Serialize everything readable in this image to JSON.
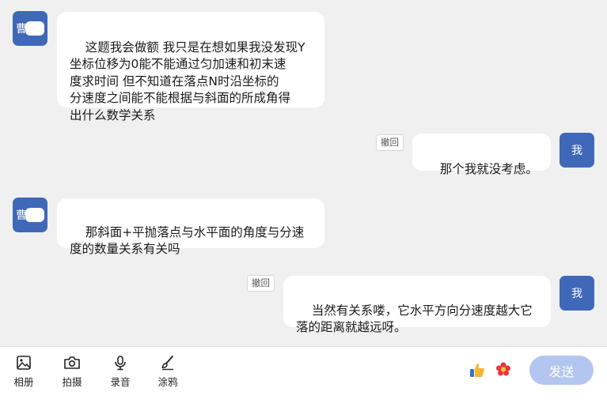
{
  "messages": [
    {
      "sender": "other",
      "avatar_char": "曹",
      "text": "这题我会做额 我只是在想如果我没发现Y\n坐标位移为0能不能通过匀加速和初末速\n度求时间 但不知道在落点N时沿坐标的\n分速度之间能不能根据与斜面的所成角得\n出什么数学关系"
    },
    {
      "sender": "me",
      "avatar_char": "我",
      "text": "那个我就没考虑。",
      "recall_label": "撤回"
    },
    {
      "sender": "other",
      "avatar_char": "曹",
      "text": "那斜面+平抛落点与水平面的角度与分速\n度的数量关系有关吗"
    },
    {
      "sender": "me",
      "avatar_char": "我",
      "text": "当然有关系喽，它水平方向分速度越大它\n落的距离就越远呀。",
      "recall_label": "撤回"
    }
  ],
  "toolbar": {
    "tools": [
      {
        "label": "相册",
        "icon": "image-icon"
      },
      {
        "label": "拍摄",
        "icon": "camera-icon"
      },
      {
        "label": "录音",
        "icon": "microphone-icon"
      },
      {
        "label": "涂鸦",
        "icon": "brush-icon"
      }
    ],
    "reactions": [
      "thumbs-up-icon",
      "flower-icon"
    ],
    "send_label": "发送"
  },
  "colors": {
    "avatar": "#3f68b8",
    "send_button": "#b3c6ef",
    "background": "#f0f0f0"
  }
}
